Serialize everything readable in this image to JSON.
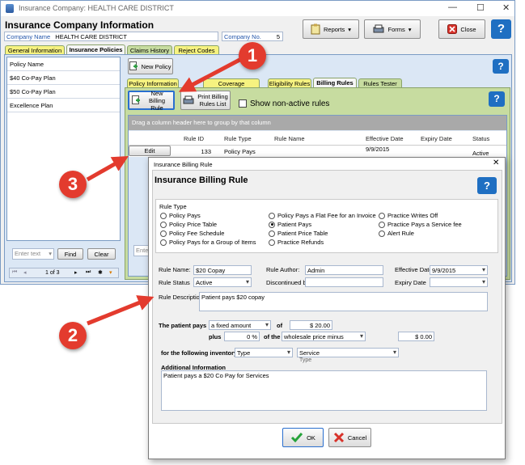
{
  "window": {
    "title": "Insurance Company: HEALTH CARE DISTRICT",
    "heading": "Insurance Company Information",
    "company_name_label": "Company Name",
    "company_name": "HEALTH CARE DISTRICT",
    "company_no_label": "Company No.",
    "company_no": "5"
  },
  "toolbar": {
    "reports": "Reports",
    "forms": "Forms",
    "close": "Close"
  },
  "main_tabs": [
    "General Information",
    "Insurance Policies",
    "Claims History",
    "Reject Codes"
  ],
  "policies": [
    "Policy Name",
    "$40 Co-Pay Plan",
    "$50 Co-Pay Plan",
    "Excellence Plan"
  ],
  "policy_search": {
    "placeholder": "Enter text",
    "find": "Find",
    "clear": "Clear",
    "page": "1 of 3"
  },
  "new_policy": "New Policy",
  "policy_tabs": [
    "Policy Information",
    "Coverage Description",
    "Eligibility Rules",
    "Billing Rules",
    "Rules Tester"
  ],
  "billing": {
    "new_rule": "New Billing Rule",
    "print_rules": "Print Billing Rules List",
    "show_inactive": "Show non-active rules",
    "group_hint": "Drag a column header here to group by that column",
    "columns": [
      "Rule ID",
      "Rule Type",
      "Rule Name",
      "Effective Date",
      "Expiry Date",
      "Status"
    ],
    "row": {
      "action": "Edit",
      "rule_id": "133",
      "rule_type": "Policy Pays",
      "rule_name": "",
      "effective": "9/9/2015",
      "expiry": "",
      "status": "Active"
    },
    "search_placeholder": "Ente"
  },
  "dialog": {
    "titlebar": "Insurance Billing Rule",
    "heading": "Insurance Billing Rule",
    "rule_type_label": "Rule Type",
    "rule_types": [
      [
        "Policy Pays",
        "Policy Pays a Flat Fee for an Invoice",
        "Practice Writes Off"
      ],
      [
        "Policy Price Table",
        "Patient Pays",
        "Practice Pays a Service fee"
      ],
      [
        "Policy Fee Schedule",
        "Patient Price Table",
        "Alert Rule"
      ],
      [
        "Policy Pays for a Group of Items",
        "Practice Refunds",
        ""
      ]
    ],
    "rule_name_label": "Rule Name:",
    "rule_name": "$20 Copay",
    "rule_author_label": "Rule Author:",
    "rule_author": "Admin",
    "effective_date_label": "Effective Date",
    "effective_date": "9/9/2015",
    "rule_status_label": "Rule Status",
    "rule_status": "Active",
    "discontinued_label": "Discontinued by:",
    "discontinued_by": "",
    "expiry_date_label": "Expiry Date",
    "expiry_date": "",
    "description_label": "Rule Description",
    "description": "Patient pays $20 copay",
    "patient_pays_label": "The patient pays",
    "patient_pays_mode": "a fixed amount",
    "of_label": "of",
    "amount": "$ 20.00",
    "plus_label": "plus",
    "percent": "0 %",
    "of_the_label": "of the",
    "price_basis": "wholesale price minus",
    "minus_amount": "$ 0.00",
    "inventory_label": "for the following inventory",
    "inventory_field": "Type",
    "inventory_value": "Service",
    "inventory_caption": "Type",
    "additional_label": "Additional Information",
    "additional_info": "Patient pays a $20 Co Pay for Services",
    "ok": "OK",
    "cancel": "Cancel"
  },
  "callouts": [
    "1",
    "2",
    "3"
  ],
  "colors": {
    "accent_red": "#e33b2e",
    "tab_yellow": "#f6f280",
    "tab_green": "#c7dca0",
    "panel_blue": "#dbe7f5"
  }
}
